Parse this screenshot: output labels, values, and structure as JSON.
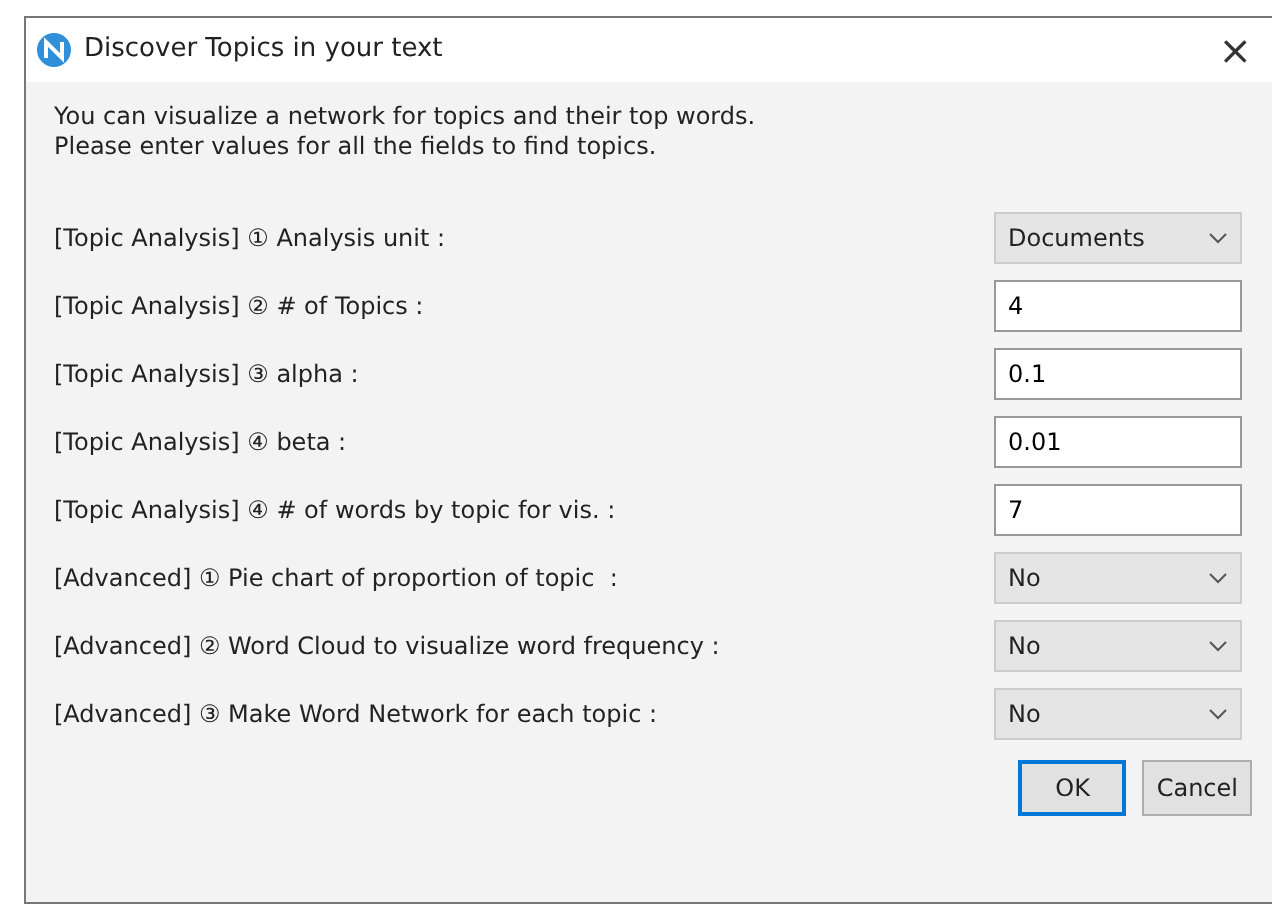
{
  "window": {
    "title": "Discover Topics in your text",
    "close": "×"
  },
  "intro": [
    "You can visualize a network for topics and their top words.",
    "Please enter values for all the fields to find topics."
  ],
  "fields": [
    {
      "label": "[Topic Analysis] ① Analysis unit :",
      "kind": "select",
      "value": "Documents"
    },
    {
      "label": "[Topic Analysis] ② # of Topics :",
      "kind": "text",
      "value": "4"
    },
    {
      "label": "[Topic Analysis] ③ alpha :",
      "kind": "text",
      "value": "0.1"
    },
    {
      "label": "[Topic Analysis] ④ beta :",
      "kind": "text",
      "value": "0.01"
    },
    {
      "label": "[Topic Analysis] ④ # of words by topic for vis. :",
      "kind": "text",
      "value": "7"
    },
    {
      "label": "[Advanced] ① Pie chart of proportion of topic  :",
      "kind": "select",
      "value": "No"
    },
    {
      "label": "[Advanced] ② Word Cloud to visualize word frequency :",
      "kind": "select",
      "value": "No"
    },
    {
      "label": "[Advanced] ③ Make Word Network for each topic :",
      "kind": "select",
      "value": "No"
    }
  ],
  "buttons": [
    {
      "label": "OK",
      "default": true
    },
    {
      "label": "Cancel",
      "default": false
    }
  ]
}
